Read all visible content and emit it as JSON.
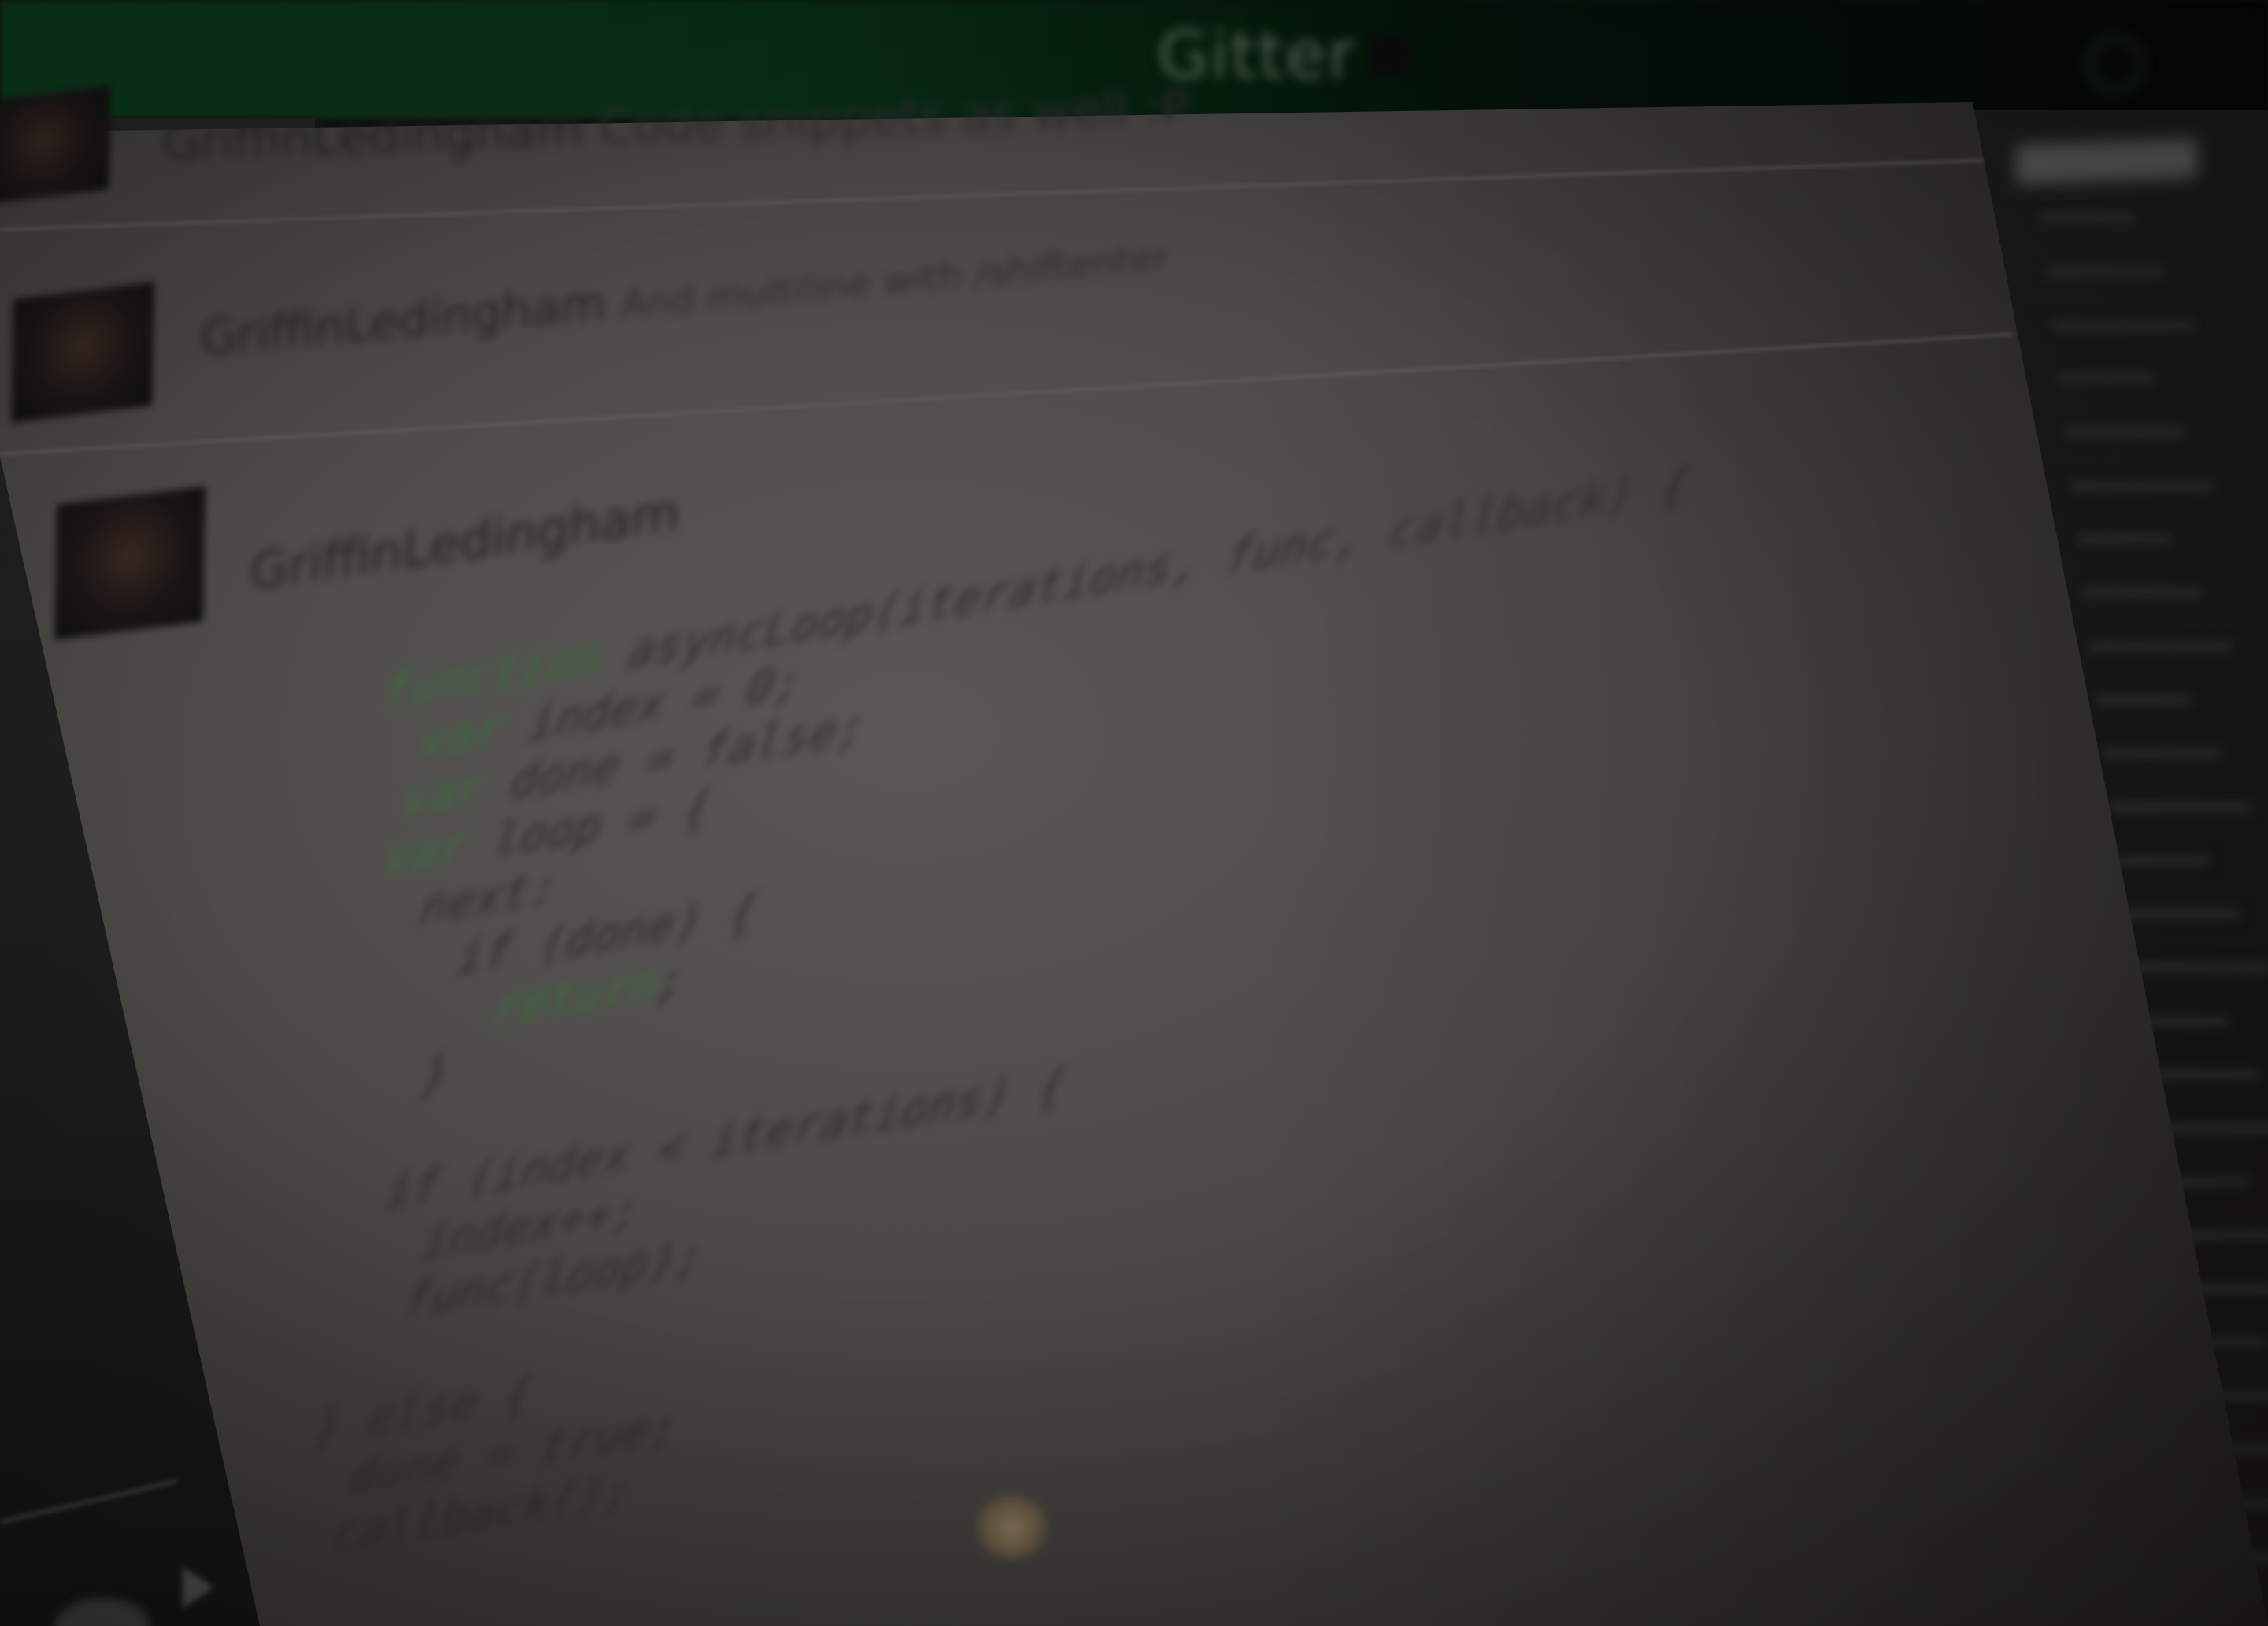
{
  "header": {
    "logo_text": "Gitter",
    "accent_color": "#0b3a1c"
  },
  "messages": [
    {
      "user": "GriffinLedingham",
      "text": "Code snippets as well :P"
    },
    {
      "user": "GriffinLedingham",
      "text": "And multiline with /shiftenter"
    },
    {
      "user": "GriffinLedingham",
      "text": ""
    }
  ],
  "code_snippet": {
    "keyword_color": "#3b6b3e",
    "lines": [
      {
        "kw": "",
        "rest": ""
      },
      {
        "kw": "function",
        "rest": " asyncLoop(iterations, func, callback) {"
      },
      {
        "kw": "  var",
        "rest": " index = 0;"
      },
      {
        "kw": "  var",
        "rest": " done = false;"
      },
      {
        "kw": "  var",
        "rest": " loop = {"
      },
      {
        "kw": "",
        "rest": "    next: "
      },
      {
        "kw": "",
        "rest": "      if (done) {"
      },
      {
        "kw": "        return",
        "rest": ";"
      },
      {
        "kw": "",
        "rest": "      }"
      },
      {
        "kw": "",
        "rest": ""
      },
      {
        "kw": "",
        "rest": "      if (index < iterations) {"
      },
      {
        "kw": "",
        "rest": "        index++;"
      },
      {
        "kw": "",
        "rest": "        func(loop);"
      },
      {
        "kw": "",
        "rest": ""
      },
      {
        "kw": "",
        "rest": "      } else {"
      },
      {
        "kw": "",
        "rest": "        done = true;"
      },
      {
        "kw": "",
        "rest": "        callback();"
      }
    ]
  }
}
